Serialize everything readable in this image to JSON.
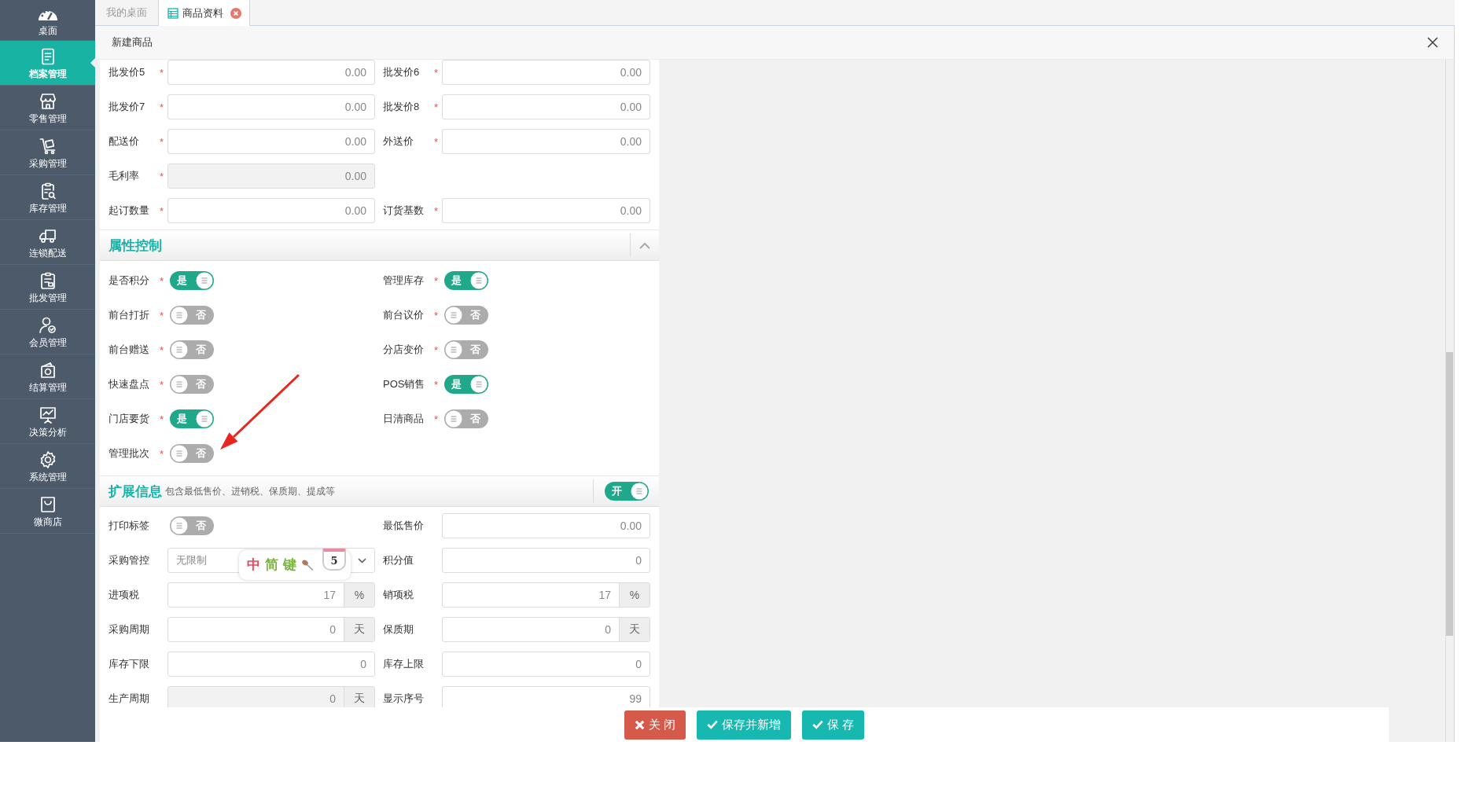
{
  "sidebar": {
    "items": [
      {
        "label": "桌面",
        "selected": false
      },
      {
        "label": "档案管理",
        "selected": true
      },
      {
        "label": "零售管理",
        "selected": false
      },
      {
        "label": "采购管理",
        "selected": false
      },
      {
        "label": "库存管理",
        "selected": false
      },
      {
        "label": "连锁配送",
        "selected": false
      },
      {
        "label": "批发管理",
        "selected": false
      },
      {
        "label": "会员管理",
        "selected": false
      },
      {
        "label": "结算管理",
        "selected": false
      },
      {
        "label": "决策分析",
        "selected": false
      },
      {
        "label": "系统管理",
        "selected": false
      },
      {
        "label": "微商店",
        "selected": false
      }
    ]
  },
  "tabs": [
    {
      "label": "我的桌面",
      "kind": "home",
      "selected": false
    },
    {
      "label": "商品资料",
      "kind": "page",
      "selected": true
    }
  ],
  "dialog": {
    "title": "新建商品"
  },
  "price_rows": [
    [
      {
        "label": "批发价5",
        "mark": "*",
        "value": "0.00",
        "disabled": false
      },
      {
        "label": "批发价6",
        "mark": "*",
        "value": "0.00",
        "disabled": false
      }
    ],
    [
      {
        "label": "批发价7",
        "mark": "*",
        "value": "0.00",
        "disabled": false
      },
      {
        "label": "批发价8",
        "mark": "*",
        "value": "0.00",
        "disabled": false
      }
    ],
    [
      {
        "label": "配送价",
        "mark": "*",
        "value": "0.00",
        "disabled": false
      },
      {
        "label": "外送价",
        "mark": "*",
        "value": "0.00",
        "disabled": false
      }
    ],
    [
      {
        "label": "毛利率",
        "mark": "*",
        "value": "0.00",
        "disabled": true
      }
    ],
    [
      {
        "label": "起订数量",
        "mark": "*",
        "value": "0.00",
        "disabled": false
      },
      {
        "label": "订货基数",
        "mark": "*",
        "value": "0.00",
        "disabled": false
      }
    ]
  ],
  "attribute_section": {
    "title": "属性控制",
    "expanded": true,
    "switches": [
      {
        "label": "是否积分",
        "mark": "*",
        "on": true,
        "text": "是"
      },
      {
        "label": "管理库存",
        "mark": "*",
        "on": true,
        "text": "是"
      },
      {
        "label": "前台打折",
        "mark": "*",
        "on": false,
        "text": "否"
      },
      {
        "label": "前台议价",
        "mark": "*",
        "on": false,
        "text": "否"
      },
      {
        "label": "前台赠送",
        "mark": "*",
        "on": false,
        "text": "否"
      },
      {
        "label": "分店变价",
        "mark": "*",
        "on": false,
        "text": "否"
      },
      {
        "label": "快速盘点",
        "mark": "*",
        "on": false,
        "text": "否"
      },
      {
        "label": "POS销售",
        "mark": "*",
        "on": true,
        "text": "是"
      },
      {
        "label": "门店要货",
        "mark": "*",
        "on": true,
        "text": "是"
      },
      {
        "label": "日清商品",
        "mark": "*",
        "on": false,
        "text": "否"
      },
      {
        "label": "管理批次",
        "mark": "*",
        "on": false,
        "text": "否"
      }
    ]
  },
  "extended_section": {
    "title": "扩展信息",
    "subtitle": "包含最低售价、进销税、保质期、提成等",
    "switch": {
      "on": true,
      "text": "开"
    },
    "fields": [
      {
        "kind": "switch",
        "label": "打印标签",
        "on": false,
        "text": "否"
      },
      {
        "kind": "input",
        "label": "最低售价",
        "value": "0.00",
        "disabled": false
      },
      {
        "kind": "select",
        "label": "采购管控",
        "value": "无限制"
      },
      {
        "kind": "input",
        "label": "积分值",
        "value": "0",
        "disabled": false
      },
      {
        "kind": "unit",
        "label": "进项税",
        "value": "17",
        "unit": "%",
        "disabled": false
      },
      {
        "kind": "unit",
        "label": "销项税",
        "value": "17",
        "unit": "%",
        "disabled": false
      },
      {
        "kind": "unit",
        "label": "采购周期",
        "value": "0",
        "unit": "天",
        "disabled": false
      },
      {
        "kind": "unit",
        "label": "保质期",
        "value": "0",
        "unit": "天",
        "disabled": false
      },
      {
        "kind": "input",
        "label": "库存下限",
        "value": "0",
        "disabled": false
      },
      {
        "kind": "input",
        "label": "库存上限",
        "value": "0",
        "disabled": false
      },
      {
        "kind": "unit",
        "label": "生产周期",
        "value": "0",
        "unit": "天",
        "disabled": true
      },
      {
        "kind": "input",
        "label": "显示序号",
        "value": "99",
        "disabled": false
      }
    ]
  },
  "buttons": [
    {
      "label": "关 闭",
      "kind": "danger"
    },
    {
      "label": "保存并新增",
      "kind": "primary"
    },
    {
      "label": "保 存",
      "kind": "primary"
    }
  ],
  "ime_toolbar": {
    "items": [
      "中",
      "简",
      "键"
    ],
    "badge": "5"
  },
  "annotations": [
    {
      "kind": "arrow"
    }
  ]
}
